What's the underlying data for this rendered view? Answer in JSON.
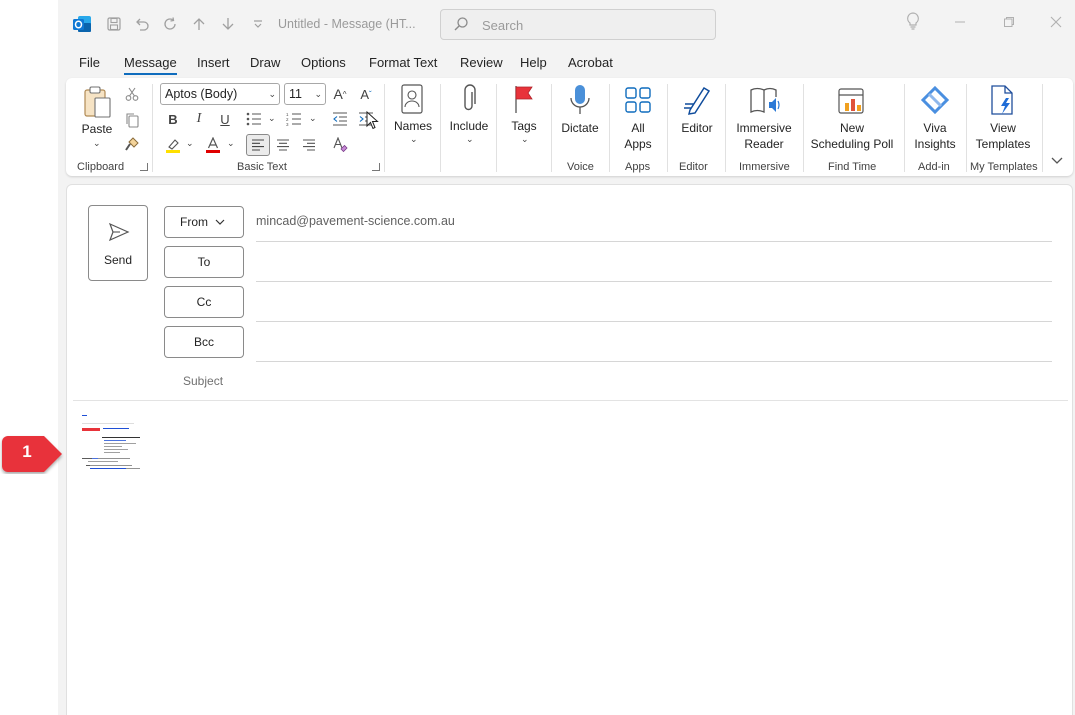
{
  "titlebar": {
    "title": "Untitled  -  Message (HT...",
    "search_placeholder": "Search"
  },
  "menu": {
    "tabs": [
      "File",
      "Message",
      "Insert",
      "Draw",
      "Options",
      "Format Text",
      "Review",
      "Help",
      "Acrobat"
    ],
    "active": "Message"
  },
  "ribbon": {
    "clipboard": {
      "paste": "Paste",
      "group": "Clipboard"
    },
    "basic_text": {
      "font": "Aptos (Body)",
      "size": "11",
      "group": "Basic Text"
    },
    "names": {
      "label": "Names"
    },
    "include": {
      "label": "Include"
    },
    "tags": {
      "label": "Tags"
    },
    "voice": {
      "dictate": "Dictate",
      "group": "Voice"
    },
    "apps": {
      "all_apps_1": "All",
      "all_apps_2": "Apps",
      "group": "Apps"
    },
    "editor": {
      "label": "Editor",
      "group": "Editor"
    },
    "immersive": {
      "label_1": "Immersive",
      "label_2": "Reader",
      "group": "Immersive"
    },
    "find_time": {
      "label_1": "New",
      "label_2": "Scheduling Poll",
      "group": "Find Time"
    },
    "addin": {
      "label_1": "Viva",
      "label_2": "Insights",
      "group": "Add-in"
    },
    "templates": {
      "label_1": "View",
      "label_2": "Templates",
      "group": "My Templates"
    }
  },
  "compose": {
    "send": "Send",
    "from_button": "From",
    "from_value": "mincad@pavement-science.com.au",
    "to_button": "To",
    "cc_button": "Cc",
    "bcc_button": "Bcc",
    "subject_label": "Subject"
  },
  "callout": {
    "number": "1"
  },
  "colors": {
    "accent": "#0f6cbd",
    "callout": "#e8333a",
    "highlight": "#ffe000",
    "font_color": "#e00000"
  }
}
